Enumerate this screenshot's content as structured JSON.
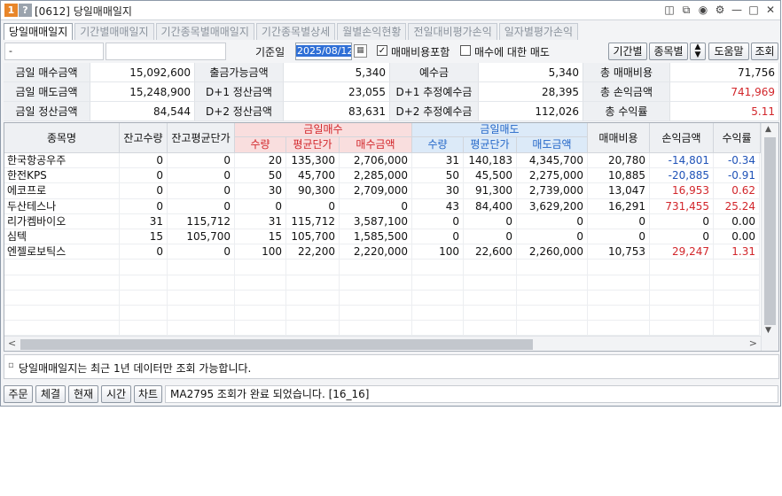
{
  "window": {
    "badge": "1",
    "help": "?",
    "title": "[0612] 당일매매일지",
    "icons": [
      "split-icon",
      "copy-icon",
      "camera-icon",
      "gear-icon",
      "minimize-icon",
      "maximize-icon",
      "close-icon"
    ]
  },
  "tabs": [
    "당일매매일지",
    "기간별매매일지",
    "기간종목별매매일지",
    "기간종목별상세",
    "월별손익현황",
    "전일대비평가손익",
    "일자별평가손익"
  ],
  "toolbar": {
    "account": "-",
    "account_name": "",
    "date_label": "기준일",
    "date_value": "2025/08/12",
    "include_fee_label": "매매비용포함",
    "include_fee_checked": true,
    "per_sell_label": "매수에 대한 매도",
    "per_sell_checked": false,
    "btn_period": "기간별",
    "btn_stock": "종목별",
    "btn_help": "도움말",
    "btn_query": "조회"
  },
  "summary": [
    [
      {
        "label": "금일 매수금액",
        "value": "15,092,600"
      },
      {
        "label": "출금가능금액",
        "value": "5,340"
      },
      {
        "label": "예수금",
        "value": "5,340"
      },
      {
        "label": "총 매매비용",
        "value": "71,756",
        "color": ""
      }
    ],
    [
      {
        "label": "금일 매도금액",
        "value": "15,248,900"
      },
      {
        "label": "D+1 정산금액",
        "value": "23,055"
      },
      {
        "label": "D+1 추정예수금",
        "value": "28,395"
      },
      {
        "label": "총 손익금액",
        "value": "741,969",
        "color": "red"
      }
    ],
    [
      {
        "label": "금일 정산금액",
        "value": "84,544"
      },
      {
        "label": "D+2 정산금액",
        "value": "83,631"
      },
      {
        "label": "D+2 추정예수금",
        "value": "112,026"
      },
      {
        "label": "총 수익률",
        "value": "5.11",
        "color": "red"
      }
    ]
  ],
  "grid": {
    "headers": {
      "name": "종목명",
      "hold_qty": "잔고수량",
      "hold_avg": "잔고평균단가",
      "buy_group": "금일매수",
      "sell_group": "금일매도",
      "qty": "수량",
      "avg": "평균단가",
      "buy_amt": "매수금액",
      "sell_amt": "매도금액",
      "fee": "매매비용",
      "pnl": "손익금액",
      "rate": "수익률"
    },
    "rows": [
      {
        "name": "한국항공우주",
        "hold_qty": "0",
        "hold_avg": "0",
        "buy_qty": "20",
        "buy_avg": "135,300",
        "buy_amt": "2,706,000",
        "sell_qty": "31",
        "sell_avg": "140,183",
        "sell_amt": "4,345,700",
        "fee": "20,780",
        "pnl": "-14,801",
        "rate": "-0.34",
        "tone": "blue"
      },
      {
        "name": "한전KPS",
        "hold_qty": "0",
        "hold_avg": "0",
        "buy_qty": "50",
        "buy_avg": "45,700",
        "buy_amt": "2,285,000",
        "sell_qty": "50",
        "sell_avg": "45,500",
        "sell_amt": "2,275,000",
        "fee": "10,885",
        "pnl": "-20,885",
        "rate": "-0.91",
        "tone": "blue"
      },
      {
        "name": "에코프로",
        "hold_qty": "0",
        "hold_avg": "0",
        "buy_qty": "30",
        "buy_avg": "90,300",
        "buy_amt": "2,709,000",
        "sell_qty": "30",
        "sell_avg": "91,300",
        "sell_amt": "2,739,000",
        "fee": "13,047",
        "pnl": "16,953",
        "rate": "0.62",
        "tone": "red"
      },
      {
        "name": "두산테스나",
        "hold_qty": "0",
        "hold_avg": "0",
        "buy_qty": "0",
        "buy_avg": "0",
        "buy_amt": "0",
        "sell_qty": "43",
        "sell_avg": "84,400",
        "sell_amt": "3,629,200",
        "fee": "16,291",
        "pnl": "731,455",
        "rate": "25.24",
        "tone": "red"
      },
      {
        "name": "리가켐바이오",
        "hold_qty": "31",
        "hold_avg": "115,712",
        "buy_qty": "31",
        "buy_avg": "115,712",
        "buy_amt": "3,587,100",
        "sell_qty": "0",
        "sell_avg": "0",
        "sell_amt": "0",
        "fee": "0",
        "pnl": "0",
        "rate": "0.00",
        "tone": ""
      },
      {
        "name": "심텍",
        "hold_qty": "15",
        "hold_avg": "105,700",
        "buy_qty": "15",
        "buy_avg": "105,700",
        "buy_amt": "1,585,500",
        "sell_qty": "0",
        "sell_avg": "0",
        "sell_amt": "0",
        "fee": "0",
        "pnl": "0",
        "rate": "0.00",
        "tone": ""
      },
      {
        "name": "엔젤로보틱스",
        "hold_qty": "0",
        "hold_avg": "0",
        "buy_qty": "100",
        "buy_avg": "22,200",
        "buy_amt": "2,220,000",
        "sell_qty": "100",
        "sell_avg": "22,600",
        "sell_amt": "2,260,000",
        "fee": "10,753",
        "pnl": "29,247",
        "rate": "1.31",
        "tone": "red"
      }
    ],
    "empty_rows": 5
  },
  "notice": "당일매매일지는 최근 1년 데이터만 조회 가능합니다.",
  "statusbar": {
    "buttons": [
      "주문",
      "체결",
      "현재",
      "시간",
      "차트"
    ],
    "message": "MA2795 조회가 완료 되었습니다. [16_16]"
  },
  "colors": {
    "red": "#d2262b",
    "blue": "#2053b8",
    "buy_header_bg": "#f9dede",
    "sell_header_bg": "#dceaf8"
  }
}
